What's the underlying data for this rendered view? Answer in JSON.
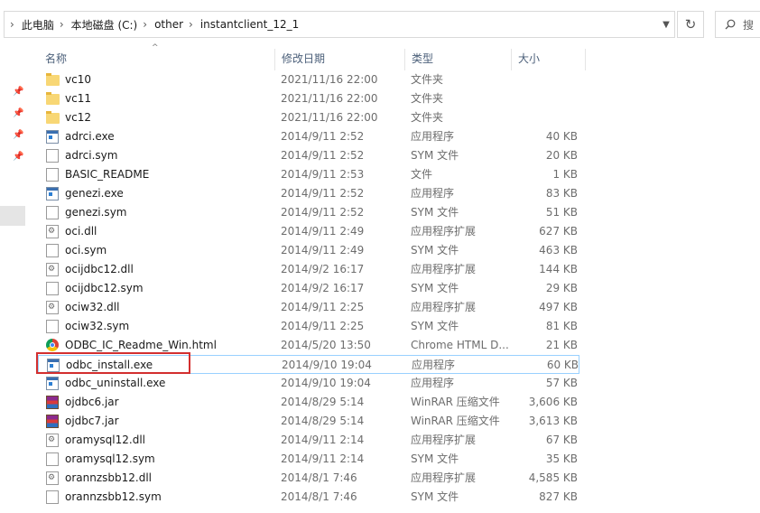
{
  "address": {
    "crumbs": [
      "此电脑",
      "本地磁盘 (C:)",
      "other",
      "instantclient_12_1"
    ],
    "search_placeholder": "搜"
  },
  "columns": {
    "name": "名称",
    "date": "修改日期",
    "type": "类型",
    "size": "大小"
  },
  "files": [
    {
      "name": "vc10",
      "date": "2021/11/16 22:00",
      "type": "文件夹",
      "size": "",
      "icon": "folder"
    },
    {
      "name": "vc11",
      "date": "2021/11/16 22:00",
      "type": "文件夹",
      "size": "",
      "icon": "folder"
    },
    {
      "name": "vc12",
      "date": "2021/11/16 22:00",
      "type": "文件夹",
      "size": "",
      "icon": "folder"
    },
    {
      "name": "adrci.exe",
      "date": "2014/9/11 2:52",
      "type": "应用程序",
      "size": "40 KB",
      "icon": "exe"
    },
    {
      "name": "adrci.sym",
      "date": "2014/9/11 2:52",
      "type": "SYM 文件",
      "size": "20 KB",
      "icon": "file"
    },
    {
      "name": "BASIC_README",
      "date": "2014/9/11 2:53",
      "type": "文件",
      "size": "1 KB",
      "icon": "file"
    },
    {
      "name": "genezi.exe",
      "date": "2014/9/11 2:52",
      "type": "应用程序",
      "size": "83 KB",
      "icon": "exe"
    },
    {
      "name": "genezi.sym",
      "date": "2014/9/11 2:52",
      "type": "SYM 文件",
      "size": "51 KB",
      "icon": "file"
    },
    {
      "name": "oci.dll",
      "date": "2014/9/11 2:49",
      "type": "应用程序扩展",
      "size": "627 KB",
      "icon": "dll"
    },
    {
      "name": "oci.sym",
      "date": "2014/9/11 2:49",
      "type": "SYM 文件",
      "size": "463 KB",
      "icon": "file"
    },
    {
      "name": "ocijdbc12.dll",
      "date": "2014/9/2 16:17",
      "type": "应用程序扩展",
      "size": "144 KB",
      "icon": "dll"
    },
    {
      "name": "ocijdbc12.sym",
      "date": "2014/9/2 16:17",
      "type": "SYM 文件",
      "size": "29 KB",
      "icon": "file"
    },
    {
      "name": "ociw32.dll",
      "date": "2014/9/11 2:25",
      "type": "应用程序扩展",
      "size": "497 KB",
      "icon": "dll"
    },
    {
      "name": "ociw32.sym",
      "date": "2014/9/11 2:25",
      "type": "SYM 文件",
      "size": "81 KB",
      "icon": "file"
    },
    {
      "name": "ODBC_IC_Readme_Win.html",
      "date": "2014/5/20 13:50",
      "type": "Chrome HTML D...",
      "size": "21 KB",
      "icon": "chrome"
    },
    {
      "name": "odbc_install.exe",
      "date": "2014/9/10 19:04",
      "type": "应用程序",
      "size": "60 KB",
      "icon": "exe",
      "selected": true
    },
    {
      "name": "odbc_uninstall.exe",
      "date": "2014/9/10 19:04",
      "type": "应用程序",
      "size": "57 KB",
      "icon": "exe"
    },
    {
      "name": "ojdbc6.jar",
      "date": "2014/8/29 5:14",
      "type": "WinRAR 压缩文件",
      "size": "3,606 KB",
      "icon": "jar"
    },
    {
      "name": "ojdbc7.jar",
      "date": "2014/8/29 5:14",
      "type": "WinRAR 压缩文件",
      "size": "3,613 KB",
      "icon": "jar"
    },
    {
      "name": "oramysql12.dll",
      "date": "2014/9/11 2:14",
      "type": "应用程序扩展",
      "size": "67 KB",
      "icon": "dll"
    },
    {
      "name": "oramysql12.sym",
      "date": "2014/9/11 2:14",
      "type": "SYM 文件",
      "size": "35 KB",
      "icon": "file"
    },
    {
      "name": "orannzsbb12.dll",
      "date": "2014/8/1 7:46",
      "type": "应用程序扩展",
      "size": "4,585 KB",
      "icon": "dll"
    },
    {
      "name": "orannzsbb12.sym",
      "date": "2014/8/1 7:46",
      "type": "SYM 文件",
      "size": "827 KB",
      "icon": "file"
    }
  ]
}
